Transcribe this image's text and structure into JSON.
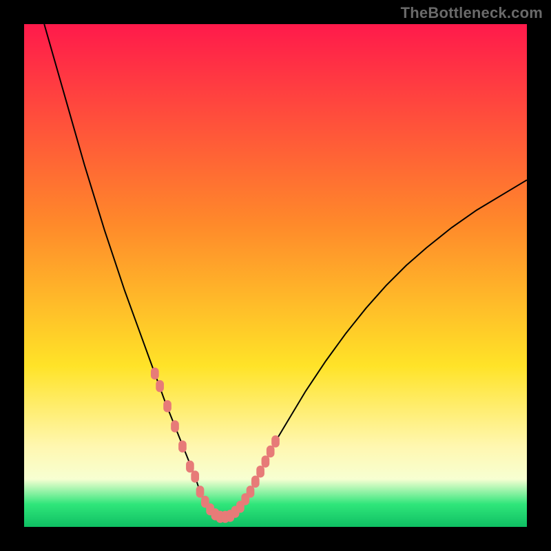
{
  "watermark": "TheBottleneck.com",
  "colors": {
    "frame": "#000000",
    "curve": "#000000",
    "markers": "#e77b78",
    "grad_top": "#ff1a4b",
    "grad_mid_upper": "#ff8a2a",
    "grad_mid": "#ffe328",
    "grad_low_yellow": "#fff7b0",
    "grad_band": "#f7ffd2",
    "grad_green": "#2fe67a",
    "grad_green_deep": "#0fbf63"
  },
  "chart_data": {
    "type": "line",
    "title": "",
    "xlabel": "",
    "ylabel": "",
    "xlim": [
      0,
      100
    ],
    "ylim": [
      0,
      100
    ],
    "series": [
      {
        "name": "bottleneck-curve",
        "x": [
          4,
          6,
          8,
          10,
          12,
          14,
          16,
          18,
          20,
          22,
          24,
          26,
          28,
          30,
          32,
          34,
          35,
          36,
          37,
          38,
          39,
          40,
          42,
          44,
          46,
          48,
          50,
          53,
          56,
          60,
          64,
          68,
          72,
          76,
          80,
          85,
          90,
          95,
          100
        ],
        "values": [
          100,
          93,
          86,
          79,
          72,
          65.5,
          59,
          53,
          47,
          41.5,
          36,
          30.5,
          25,
          20,
          15,
          10,
          7,
          5,
          3.5,
          2.5,
          2,
          2,
          3,
          5.5,
          9,
          13,
          17,
          22,
          27,
          33,
          38.5,
          43.5,
          48,
          52,
          55.5,
          59.5,
          63,
          66,
          69
        ]
      }
    ],
    "markers": {
      "name": "highlighted-points",
      "x": [
        26,
        27,
        28.5,
        30,
        31.5,
        33,
        34,
        35,
        36,
        37,
        38,
        39,
        40,
        41,
        42,
        43,
        44,
        45,
        46,
        47,
        48,
        49,
        50
      ],
      "values": [
        30.5,
        28,
        24,
        20,
        16,
        12,
        10,
        7,
        5,
        3.5,
        2.5,
        2,
        2,
        2.2,
        3,
        4,
        5.5,
        7,
        9,
        11,
        13,
        15,
        17
      ]
    },
    "gradient_bands": [
      {
        "from_y": 100,
        "to_y": 30,
        "desc": "red-to-orange"
      },
      {
        "from_y": 30,
        "to_y": 15,
        "desc": "orange-to-yellow"
      },
      {
        "from_y": 15,
        "to_y": 9,
        "desc": "pale-yellow-band"
      },
      {
        "from_y": 9,
        "to_y": 3,
        "desc": "pale-green-transition"
      },
      {
        "from_y": 3,
        "to_y": 0,
        "desc": "green-bottom"
      }
    ]
  }
}
